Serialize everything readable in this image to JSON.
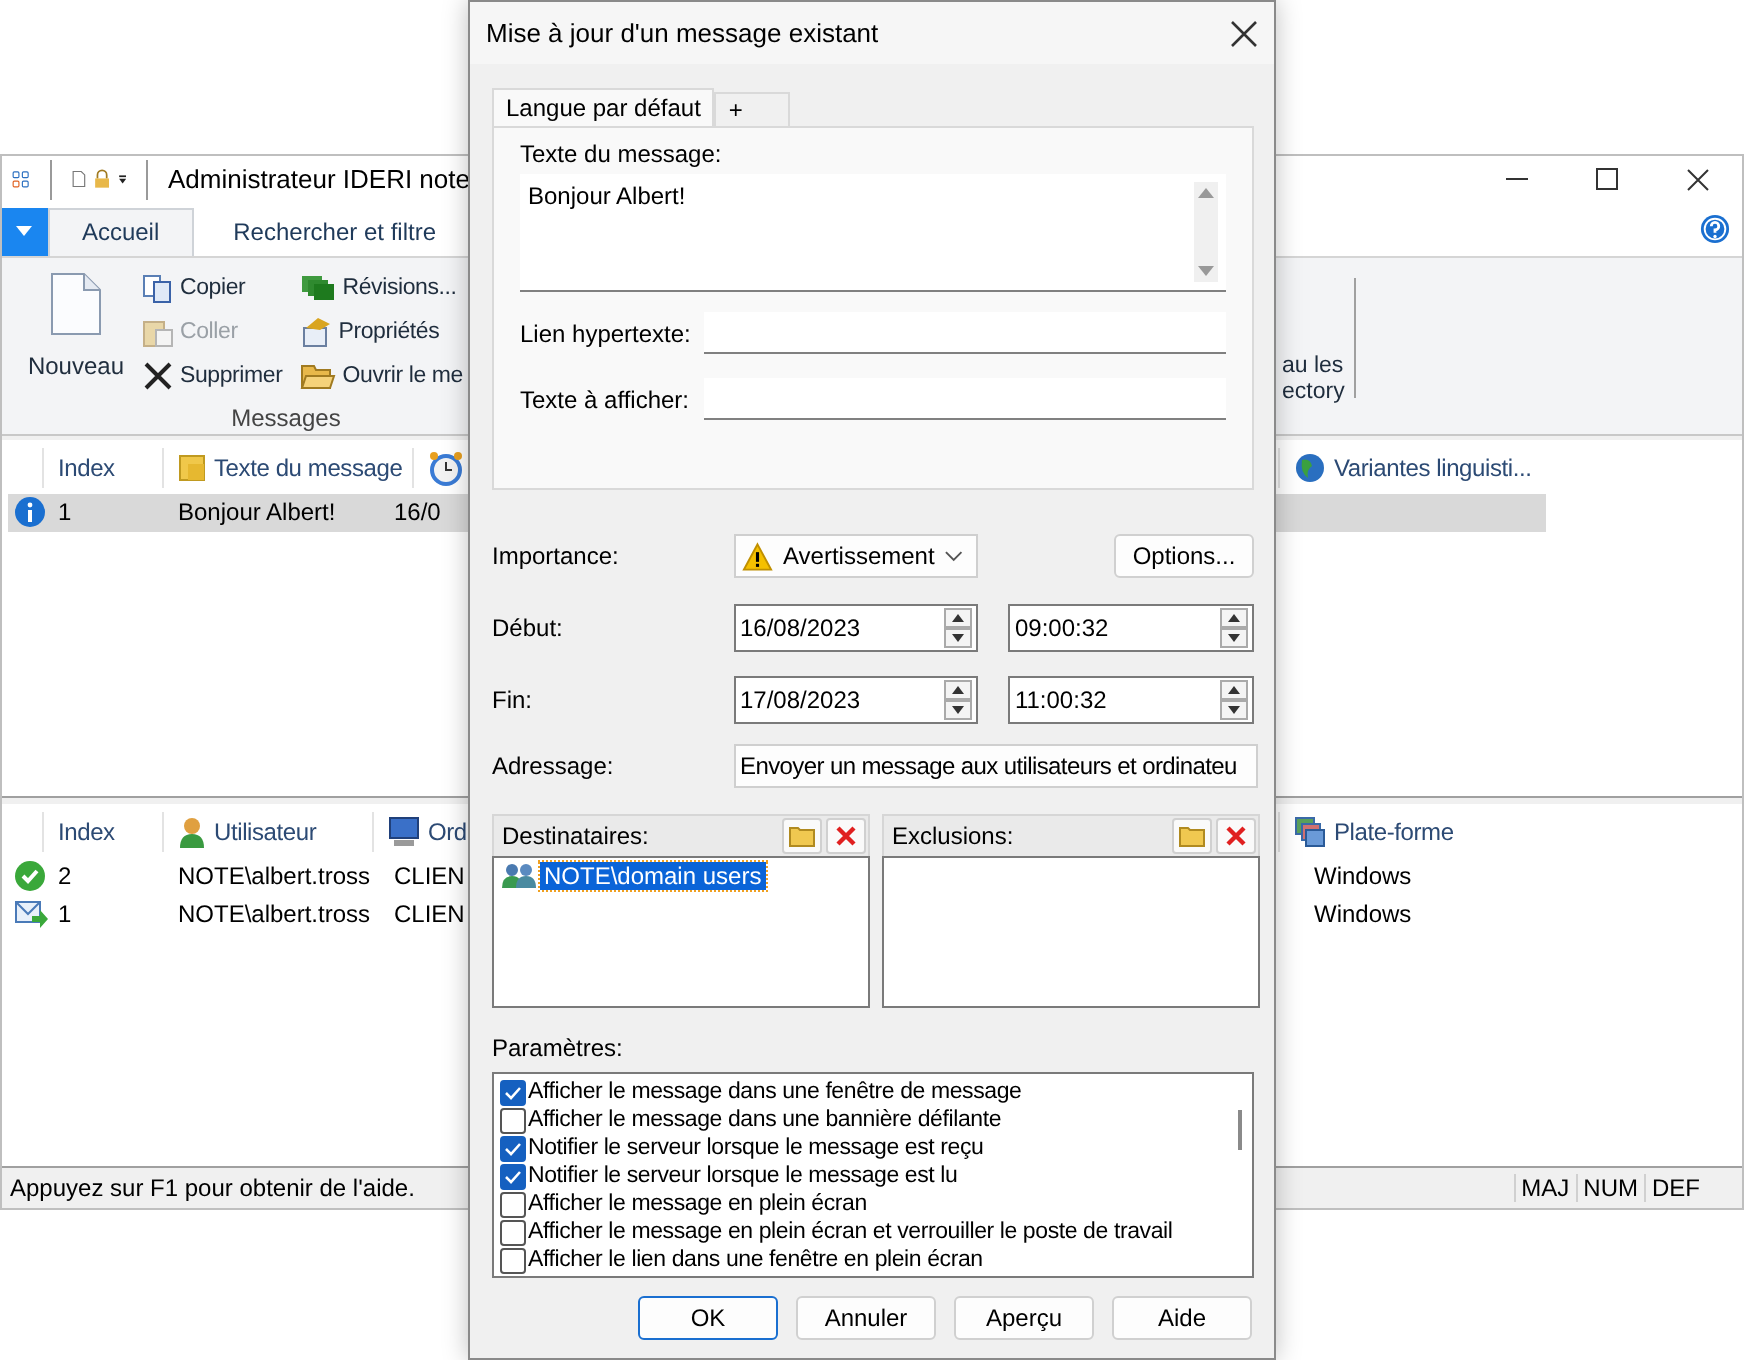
{
  "main_window": {
    "title": "Administrateur IDERI note",
    "tabs": [
      {
        "label": "Accueil",
        "selected": true
      },
      {
        "label": "Rechercher et filtre",
        "selected": false
      }
    ],
    "ribbon": {
      "big_button": "Nouveau",
      "small_buttons": [
        {
          "kind": "copy",
          "label": "Copier",
          "disabled": false
        },
        {
          "kind": "paste",
          "label": "Coller",
          "disabled": true
        },
        {
          "kind": "delete",
          "label": "Supprimer",
          "disabled": false
        },
        {
          "kind": "revisions",
          "label": "Révisions...",
          "disabled": false
        },
        {
          "kind": "properties",
          "label": "Propriétés",
          "disabled": false
        },
        {
          "kind": "open",
          "label": "Ouvrir le me",
          "disabled": false
        }
      ],
      "group_label": "Messages",
      "cut_button_lines": [
        "au les",
        "ectory"
      ]
    }
  },
  "messages_list": {
    "columns": [
      {
        "kind": "text",
        "label": "Index"
      },
      {
        "kind": "note",
        "label": "Texte du message"
      },
      {
        "kind": "clock"
      },
      {
        "kind": "globe",
        "label": "Variantes linguisti..."
      }
    ],
    "rows": [
      {
        "kind": "info",
        "selected": true,
        "cells": [
          "1",
          "Bonjour Albert!",
          "16/0"
        ]
      }
    ]
  },
  "recipients_list": {
    "columns": [
      {
        "kind": "text",
        "label": "Index"
      },
      {
        "kind": "user",
        "label": "Utilisateur"
      },
      {
        "kind": "computer",
        "label": "Ord"
      },
      {
        "kind": "platform",
        "label": "Plate-forme"
      }
    ],
    "rows": [
      {
        "kind": "done",
        "cells": [
          "2",
          "NOTE\\albert.tross",
          "CLIEN",
          "Windows"
        ]
      },
      {
        "kind": "sent",
        "cells": [
          "1",
          "NOTE\\albert.tross",
          "CLIEN",
          "Windows"
        ]
      }
    ]
  },
  "status_bar": {
    "text": "Appuyez sur F1 pour obtenir de l'aide.",
    "indicators": [
      "MAJ",
      "NUM",
      "DEF"
    ]
  },
  "dialog": {
    "title": "Mise à jour d'un message existant",
    "tabs": [
      {
        "label": "Langue par défaut",
        "selected": true
      },
      {
        "label": "+",
        "selected": false
      }
    ],
    "message_label": "Texte du message:",
    "message_value": "Bonjour Albert!",
    "link_label": "Lien hypertexte:",
    "display_label": "Texte à afficher:",
    "importance": {
      "label": "Importance:",
      "value": "Avertissement"
    },
    "options_button": "Options...",
    "start": {
      "label": "Début:",
      "date": "16/08/2023",
      "time": "09:00:32"
    },
    "end": {
      "label": "Fin:",
      "date": "17/08/2023",
      "time": "11:00:32"
    },
    "addressing": {
      "label": "Adressage:",
      "value": "Envoyer un message aux utilisateurs et ordinateu"
    },
    "recipients": {
      "label": "Destinataires:",
      "items": [
        {
          "text": "NOTE\\domain users",
          "selected": true
        }
      ]
    },
    "exclusions": {
      "label": "Exclusions:"
    },
    "parameters": {
      "label": "Paramètres:",
      "items": [
        {
          "label": "Afficher le message dans une fenêtre de message",
          "checked": true
        },
        {
          "label": "Afficher le message dans une bannière défilante",
          "checked": false
        },
        {
          "label": "Notifier le serveur lorsque le message est reçu",
          "checked": true
        },
        {
          "label": "Notifier le serveur lorsque le message est lu",
          "checked": true
        },
        {
          "label": "Afficher le message en plein écran",
          "checked": false
        },
        {
          "label": "Afficher le message en plein écran et verrouiller le poste de travail",
          "checked": false
        },
        {
          "label": "Afficher le lien dans une fenêtre en plein écran",
          "checked": false
        }
      ]
    },
    "buttons": [
      {
        "label": "OK",
        "default": true
      },
      {
        "label": "Annuler",
        "default": false
      },
      {
        "label": "Aperçu",
        "default": false
      },
      {
        "label": "Aide",
        "default": false
      }
    ]
  }
}
